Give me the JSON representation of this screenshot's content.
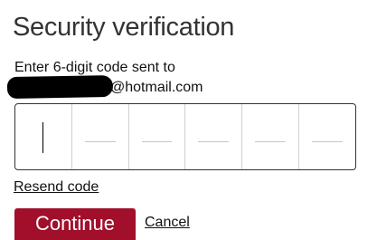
{
  "title": "Security verification",
  "instructions": {
    "line1": "Enter 6-digit code sent to",
    "email_domain": "@hotmail.com"
  },
  "code_input": {
    "digit_count": 6,
    "active_index": 0,
    "values": [
      "",
      "",
      "",
      "",
      "",
      ""
    ]
  },
  "links": {
    "resend": "Resend code",
    "cancel": "Cancel"
  },
  "buttons": {
    "continue": "Continue"
  },
  "colors": {
    "primary_button": "#a10f2b",
    "text": "#222222"
  }
}
